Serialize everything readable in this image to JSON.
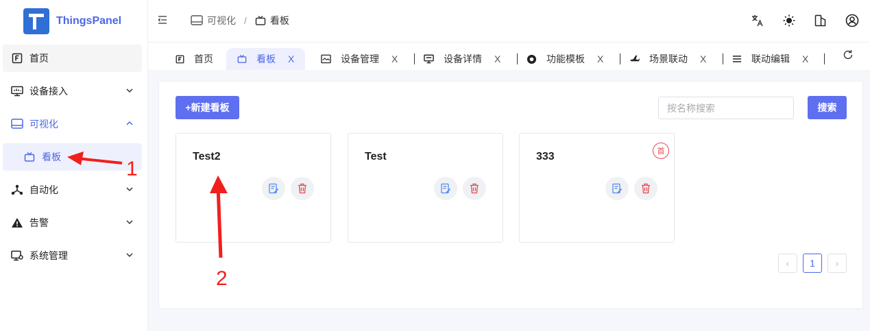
{
  "app": {
    "brand": "ThingsPanel"
  },
  "sidebar": {
    "items": [
      {
        "label": "首页",
        "icon": "home-icon"
      },
      {
        "label": "设备接入",
        "icon": "device-access-icon"
      },
      {
        "label": "可视化",
        "icon": "monitor-icon"
      },
      {
        "label": "看板",
        "icon": "tv-icon"
      },
      {
        "label": "自动化",
        "icon": "automation-icon"
      },
      {
        "label": "告警",
        "icon": "warning-icon"
      },
      {
        "label": "系统管理",
        "icon": "system-settings-icon"
      }
    ]
  },
  "header": {
    "breadcrumb": [
      "可视化",
      "看板"
    ],
    "breadcrumb_sep": "/",
    "icons": [
      "translate-icon",
      "theme-sun-icon",
      "layout-icon",
      "user-icon"
    ]
  },
  "tabs": [
    {
      "label": "首页",
      "icon": "home-icon",
      "closable": false
    },
    {
      "label": "看板",
      "icon": "tv-icon",
      "closable": true,
      "active": true
    },
    {
      "label": "设备管理",
      "icon": "image-icon",
      "closable": true
    },
    {
      "label": "设备详情",
      "icon": "monitor-icon",
      "closable": true
    },
    {
      "label": "功能模板",
      "icon": "template-icon",
      "closable": true
    },
    {
      "label": "场景联动",
      "icon": "plane-icon",
      "closable": true
    },
    {
      "label": "联动编辑",
      "icon": "menu-icon",
      "closable": true
    }
  ],
  "tab_close": "X",
  "toolbar": {
    "new_label": "+新建看板",
    "search_placeholder": "按名称搜索",
    "search_label": "搜索"
  },
  "cards": [
    {
      "title": "Test2"
    },
    {
      "title": "Test"
    },
    {
      "title": "333",
      "badge": "首"
    }
  ],
  "pagination": {
    "prev": "‹",
    "current": "1",
    "next": "›"
  },
  "annotations": {
    "label1": "1",
    "label2": "2"
  },
  "colors": {
    "accent": "#4d66e6",
    "primary_button": "#5e6ff0",
    "annotation": "#f0201c",
    "danger": "#e5484d"
  }
}
